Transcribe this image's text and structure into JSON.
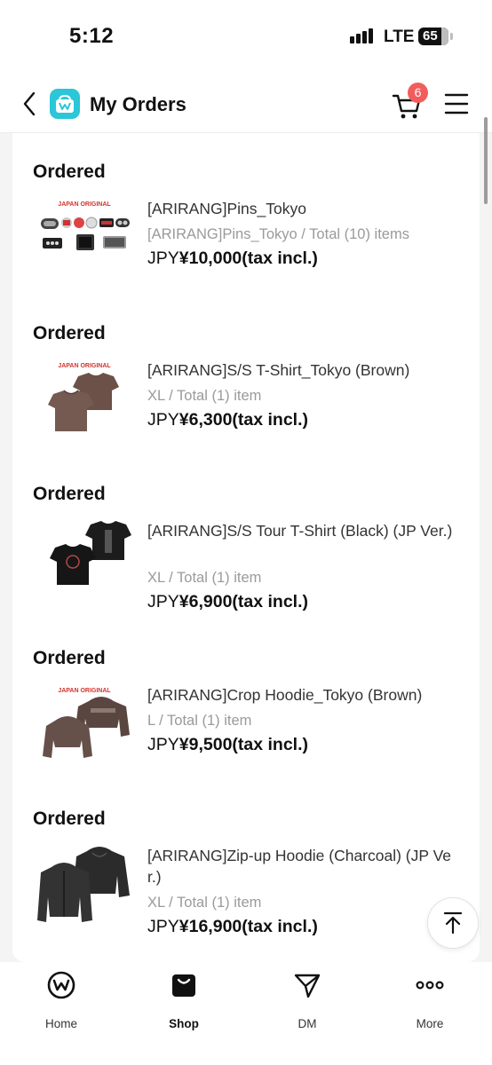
{
  "status_bar": {
    "time": "5:12",
    "network": "LTE",
    "battery": "65"
  },
  "header": {
    "title": "My Orders",
    "cart_count": "6"
  },
  "orders": [
    {
      "status": "Ordered",
      "name": "[ARIRANG]Pins_Tokyo",
      "meta": "[ARIRANG]Pins_Tokyo / Total (10) items",
      "currency": "JPY",
      "price": "¥10,000(tax incl.)",
      "thumb_label": "JAPAN ORIGINAL"
    },
    {
      "status": "Ordered",
      "name": "[ARIRANG]S/S T-Shirt_Tokyo (Brown)",
      "meta": "XL / Total (1) item",
      "currency": "JPY",
      "price": "¥6,300(tax incl.)",
      "thumb_label": "JAPAN ORIGINAL"
    },
    {
      "status": "Ordered",
      "name": "[ARIRANG]S/S Tour T-Shirt (Black) (JP Ver.)",
      "meta": "XL / Total (1) item",
      "currency": "JPY",
      "price": "¥6,900(tax incl.)",
      "thumb_label": ""
    },
    {
      "status": "Ordered",
      "name": "[ARIRANG]Crop Hoodie_Tokyo (Brown)",
      "meta": "L / Total (1) item",
      "currency": "JPY",
      "price": "¥9,500(tax incl.)",
      "thumb_label": "JAPAN ORIGINAL"
    },
    {
      "status": "Ordered",
      "name": "[ARIRANG]Zip-up Hoodie (Charcoal) (JP Ver.)",
      "meta": "XL / Total (1) item",
      "currency": "JPY",
      "price": "¥16,900(tax incl.)",
      "thumb_label": ""
    }
  ],
  "bottom_nav": [
    {
      "label": "Home",
      "icon": "weverse-home-icon"
    },
    {
      "label": "Shop",
      "icon": "shop-bag-icon",
      "active": true
    },
    {
      "label": "DM",
      "icon": "dm-send-icon"
    },
    {
      "label": "More",
      "icon": "more-dots-icon"
    }
  ],
  "colors": {
    "accent": "#2bc6d8",
    "badge": "#f25c5c",
    "muted": "#9a9a9a"
  }
}
